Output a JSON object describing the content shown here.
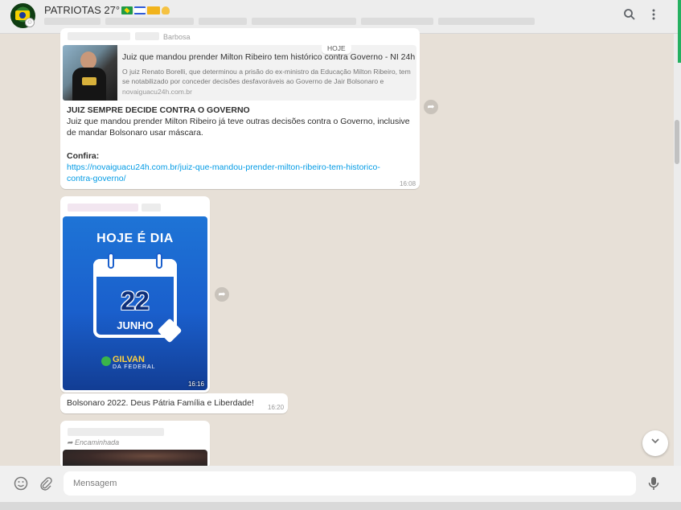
{
  "header": {
    "group_name": "PATRIOTAS 27°",
    "avatar_badge": "♲",
    "search_icon": "search-icon",
    "menu_icon": "more-vertical-icon"
  },
  "chat": {
    "date_chip": "HOJE",
    "msg1": {
      "sender": "Barbosa",
      "link_title": "Juiz que mandou prender Milton Ribeiro tem histórico contra Governo - NI 24h",
      "link_desc": "O juiz Renato Borelli, que determinou a prisão do ex-ministro da Educação Milton Ribeiro, tem se notabilizado por conceder decisões desfavoráveis ao Governo de Jair Bolsonaro e",
      "link_domain": "novaiguacu24h.com.br",
      "headline": "JUIZ SEMPRE DECIDE CONTRA O GOVERNO",
      "body_line1": "Juiz que mandou prender Milton Ribeiro já teve outras decisões contra o Governo, inclusive",
      "body_line2": "de mandar Bolsonaro usar máscara.",
      "confira": "Confira:",
      "url_line1": "https://novaiguacu24h.com.br/juiz-que-mandou-prender-milton-ribeiro-tem-historico-",
      "url_line2": "contra-governo/",
      "time": "16:08"
    },
    "msg2": {
      "image_title": "HOJE É DIA",
      "image_day": "22",
      "image_month": "JUNHO",
      "brand_line1": "GILVAN",
      "brand_line2": "DA FEDERAL",
      "image_time": "16:16"
    },
    "msg3": {
      "text": "Bolsonaro 2022. Deus Pátria Família e Liberdade!",
      "time": "16:20"
    },
    "msg4": {
      "forwarded": "Encaminhada"
    }
  },
  "footer": {
    "placeholder": "Mensagem",
    "emoji_icon": "emoji-icon",
    "attach_icon": "paperclip-icon",
    "mic_icon": "microphone-icon"
  },
  "colors": {
    "chat_bg": "#e7e0d7",
    "header_bg": "#ededed",
    "link": "#039be5",
    "online_green": "#25b060"
  }
}
